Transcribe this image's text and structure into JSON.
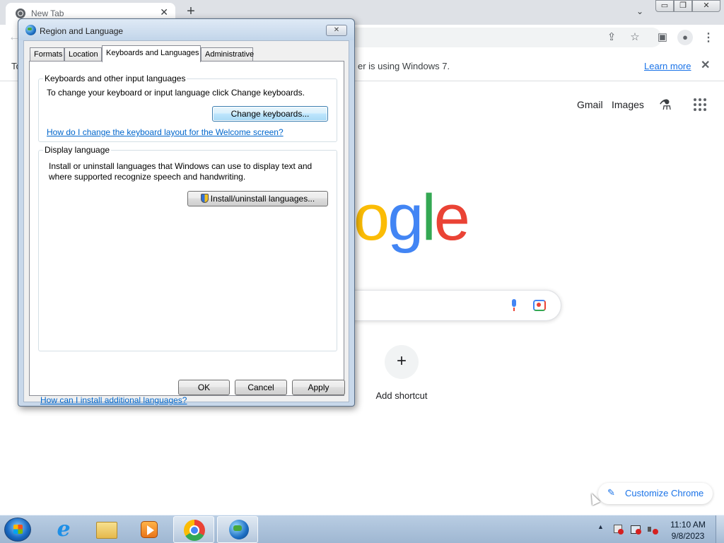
{
  "chrome": {
    "tab_title": "New Tab",
    "tab_close": "✕",
    "new_tab": "+",
    "window_controls": {
      "minimize": "▭",
      "maximize": "❐",
      "close": "✕"
    },
    "infobar": {
      "message_left": "To",
      "message_right": "er is using Windows 7.",
      "learn_more": "Learn more",
      "close": "✕"
    },
    "icons": [
      "share-icon",
      "star-icon",
      "side-panel-icon",
      "profile-icon",
      "menu-icon"
    ]
  },
  "ntp": {
    "gmail": "Gmail",
    "images": "Images",
    "logo_visible": "ogle",
    "add_shortcut_label": "Add shortcut",
    "add_shortcut_symbol": "+",
    "customize_label": "Customize Chrome",
    "logo_colors": {
      "blue": "#4285f4",
      "red": "#ea4335",
      "yellow": "#fbbc05",
      "green": "#34a853"
    }
  },
  "dialog": {
    "title": "Region and Language",
    "close": "✕",
    "tabs": [
      {
        "label": "Formats",
        "selected": false
      },
      {
        "label": "Location",
        "selected": false
      },
      {
        "label": "Keyboards and Languages",
        "selected": true
      },
      {
        "label": "Administrative",
        "selected": false
      }
    ],
    "keyboards_group": {
      "legend": "Keyboards and other input languages",
      "description": "To change your keyboard or input language click Change keyboards.",
      "button": "Change keyboards...",
      "link": "How do I change the keyboard layout for the Welcome screen?"
    },
    "display_group": {
      "legend": "Display language",
      "description": "Install or uninstall languages that Windows can use to display text and where supported recognize speech and handwriting.",
      "button": "Install/uninstall languages..."
    },
    "bottom_link": "How can I install additional languages?",
    "buttons": {
      "ok": "OK",
      "cancel": "Cancel",
      "apply": "Apply"
    }
  },
  "taskbar": {
    "apps": [
      "start-orb",
      "internet-explorer",
      "windows-explorer",
      "media-player",
      "chrome",
      "region-and-language"
    ],
    "active_apps": [
      "chrome",
      "region-and-language"
    ],
    "tray_arrow": "▲",
    "time": "11:10 AM",
    "date": "9/8/2023"
  }
}
